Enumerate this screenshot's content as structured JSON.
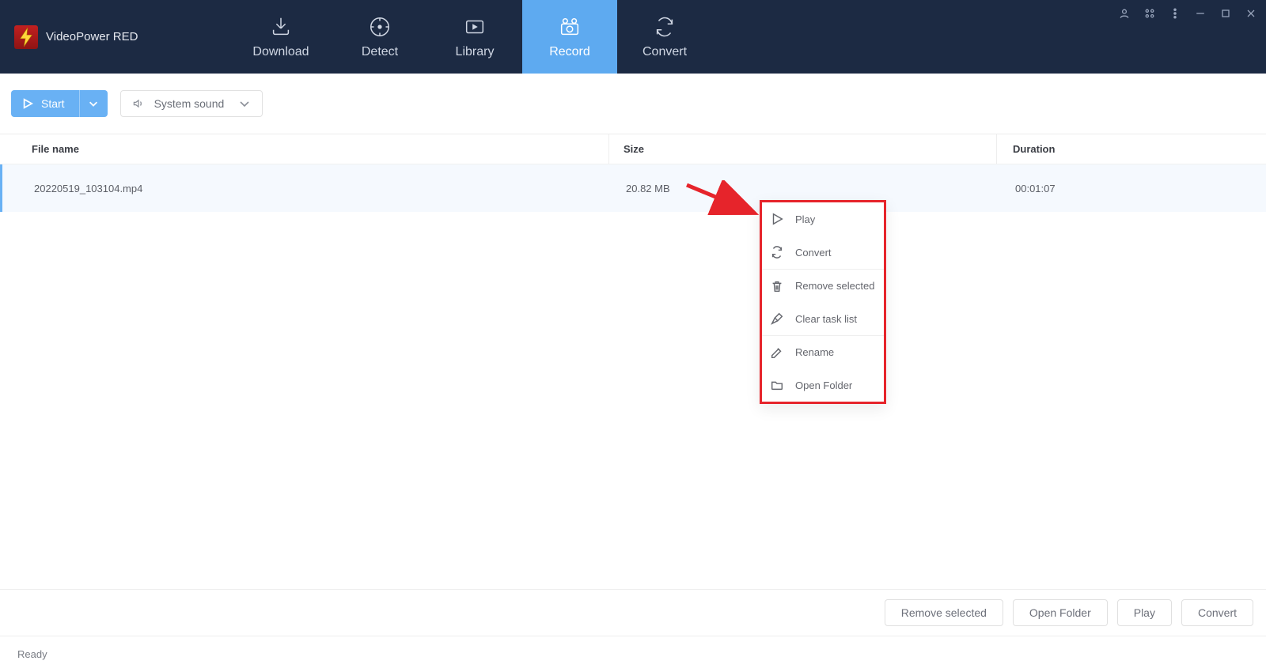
{
  "app": {
    "title": "VideoPower RED"
  },
  "nav": {
    "tabs": [
      {
        "label": "Download"
      },
      {
        "label": "Detect"
      },
      {
        "label": "Library"
      },
      {
        "label": "Record"
      },
      {
        "label": "Convert"
      }
    ],
    "active_index": 3
  },
  "toolbar": {
    "start_label": "Start",
    "sound_label": "System sound"
  },
  "table": {
    "headers": {
      "name": "File name",
      "size": "Size",
      "duration": "Duration"
    },
    "rows": [
      {
        "name": "20220519_103104.mp4",
        "size": "20.82 MB",
        "duration": "00:01:07"
      }
    ]
  },
  "context_menu": {
    "items": [
      {
        "label": "Play"
      },
      {
        "label": "Convert"
      },
      {
        "label": "Remove selected"
      },
      {
        "label": "Clear task list"
      },
      {
        "label": "Rename"
      },
      {
        "label": "Open Folder"
      }
    ]
  },
  "footer": {
    "buttons": [
      {
        "label": "Remove selected"
      },
      {
        "label": "Open Folder"
      },
      {
        "label": "Play"
      },
      {
        "label": "Convert"
      }
    ]
  },
  "status": {
    "text": "Ready"
  }
}
